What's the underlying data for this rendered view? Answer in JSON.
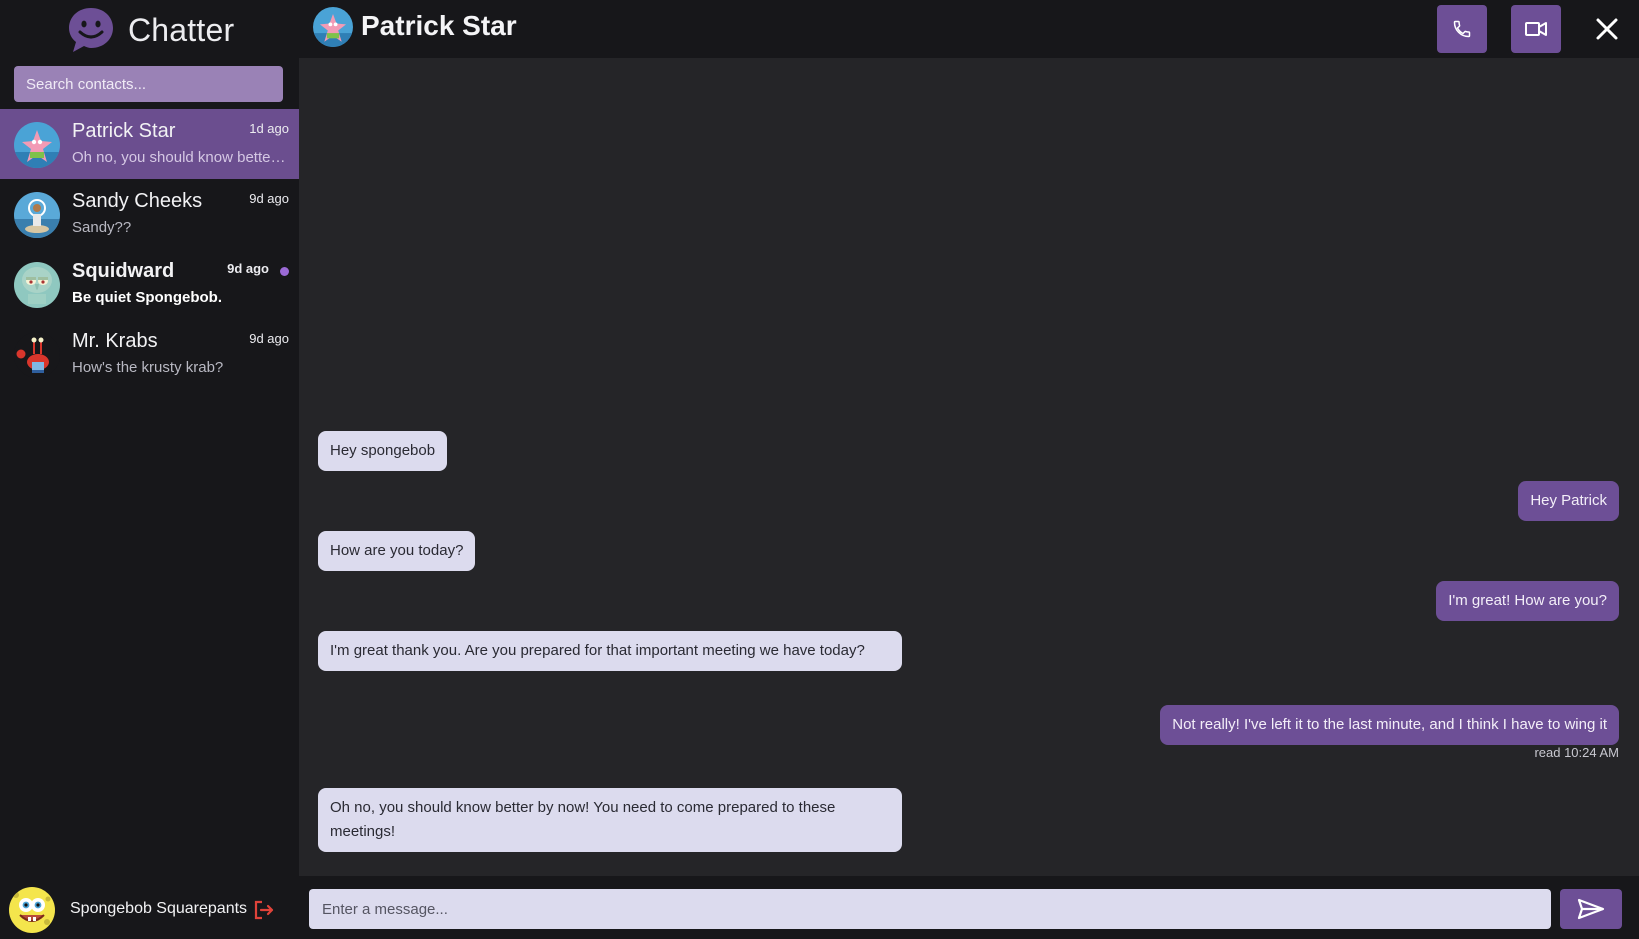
{
  "app": {
    "name": "Chatter"
  },
  "search": {
    "placeholder": "Search contacts..."
  },
  "contacts": [
    {
      "name": "Patrick Star",
      "preview": "Oh no, you should know better by now! You need to come prepared to these meetings!",
      "time": "1d ago",
      "active": true,
      "unread": false
    },
    {
      "name": "Sandy Cheeks",
      "preview": "Sandy??",
      "time": "9d ago",
      "active": false,
      "unread": false
    },
    {
      "name": "Squidward",
      "preview": "Be quiet Spongebob.",
      "time": "9d ago",
      "active": false,
      "unread": true
    },
    {
      "name": "Mr. Krabs",
      "preview": "How's the krusty krab?",
      "time": "9d ago",
      "active": false,
      "unread": false
    }
  ],
  "current_user": {
    "name": "Spongebob Squarepants"
  },
  "header": {
    "title": "Patrick Star"
  },
  "messages": [
    {
      "direction": "in",
      "text": "Hey spongebob"
    },
    {
      "direction": "out",
      "text": "Hey Patrick"
    },
    {
      "direction": "in",
      "text": "How are you today?"
    },
    {
      "direction": "out",
      "text": "I'm great! How are you?"
    },
    {
      "direction": "in",
      "text": "I'm great thank you. Are you prepared for that important meeting we have today?"
    },
    {
      "direction": "out",
      "text": "Not really! I've left it to the last minute, and I think I have to wing it"
    },
    {
      "direction": "in",
      "text": "Oh no, you should know better by now! You need to come prepared to these meetings!"
    }
  ],
  "read_receipt": "read 10:24 AM",
  "composer": {
    "placeholder": "Enter a message..."
  },
  "colors": {
    "accent": "#6d4f96",
    "sidebar": "#17171a",
    "chat_bg": "#252528",
    "incoming_bubble": "#dcdbee",
    "unread_dot": "#9b6ad6",
    "logout": "#e0433a"
  },
  "icons": {
    "logo": "chat-bubble-smile-icon",
    "call": "phone-icon",
    "video": "video-camera-icon",
    "close": "close-icon",
    "send": "send-icon",
    "logout": "logout-icon"
  }
}
